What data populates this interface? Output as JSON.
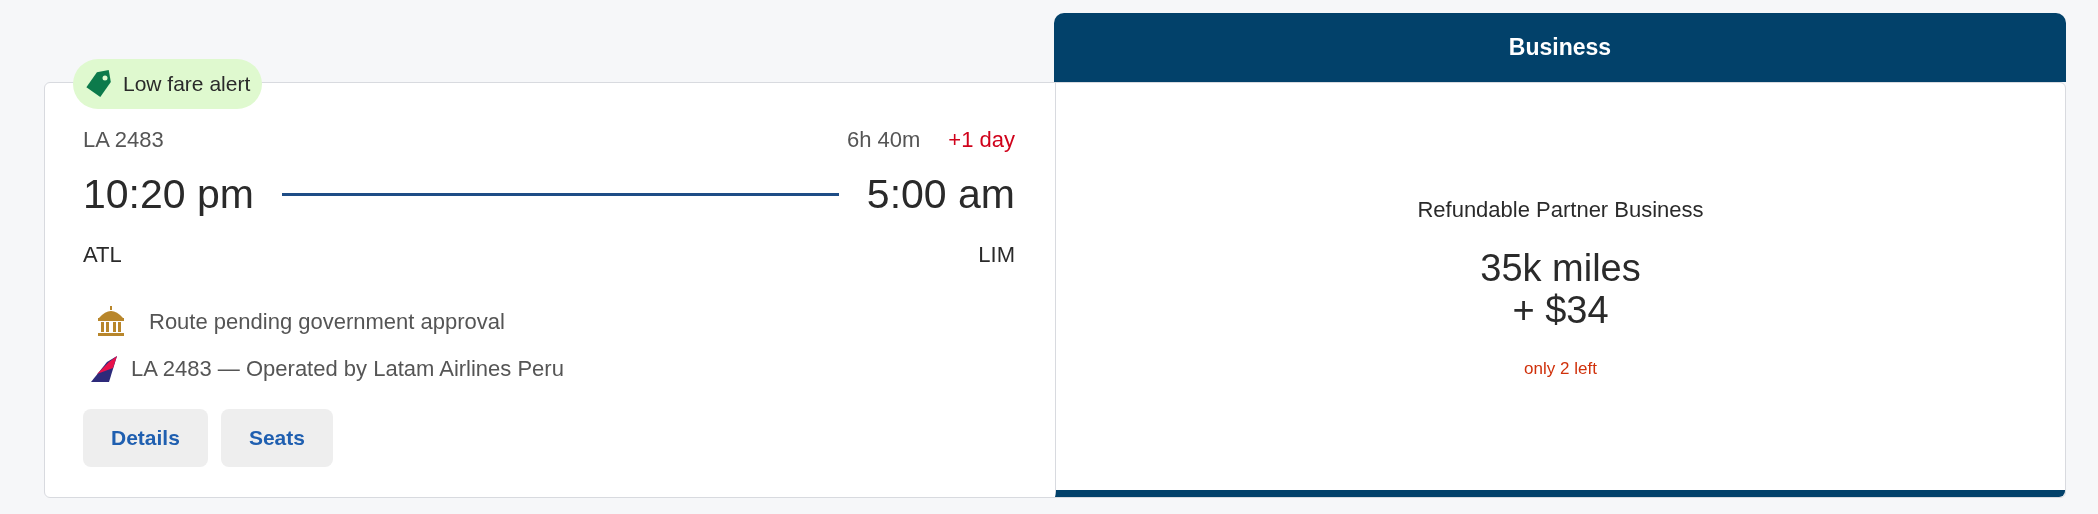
{
  "badge": {
    "label": "Low fare alert"
  },
  "flight": {
    "number": "LA 2483",
    "duration": "6h 40m",
    "day_offset": "+1 day",
    "depart_time": "10:20 pm",
    "arrive_time": "5:00 am",
    "origin": "ATL",
    "destination": "LIM"
  },
  "notices": [
    {
      "kind": "approval",
      "text": "Route pending government approval"
    },
    {
      "kind": "operator",
      "text": "LA 2483 — Operated by Latam Airlines Peru"
    }
  ],
  "buttons": [
    "Details",
    "Seats"
  ],
  "fare": {
    "cabin": "Business",
    "name": "Refundable Partner Business",
    "miles": "35k miles",
    "cash": "+ $34",
    "availability": "only 2 left"
  }
}
